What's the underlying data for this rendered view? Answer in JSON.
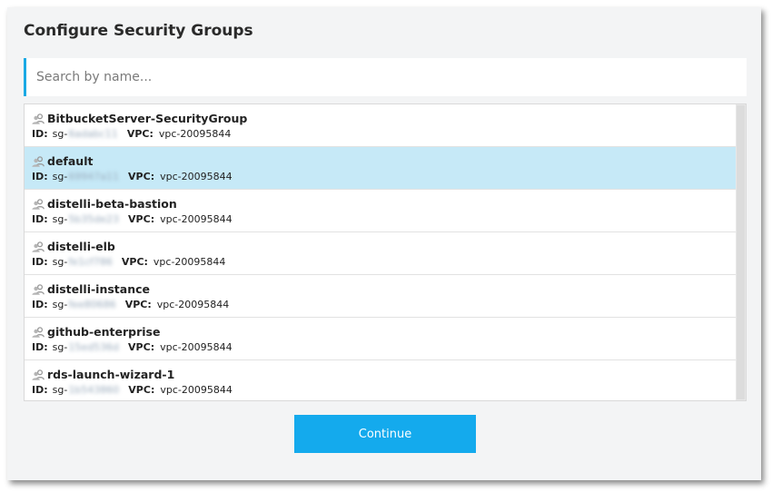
{
  "dialog": {
    "title": "Configure Security Groups",
    "search_placeholder": "Search by name...",
    "continue_label": "Continue"
  },
  "labels": {
    "id": "ID:",
    "vpc": "VPC:"
  },
  "groups": [
    {
      "name": "BitbucketServer-SecurityGroup",
      "id_prefix": "sg-",
      "id_rest": "6adabc11",
      "vpc": "vpc-20095844",
      "selected": false
    },
    {
      "name": "default",
      "id_prefix": "sg-",
      "id_rest": "69947a11",
      "vpc": "vpc-20095844",
      "selected": true
    },
    {
      "name": "distelli-beta-bastion",
      "id_prefix": "sg-",
      "id_rest": "5b35de23",
      "vpc": "vpc-20095844",
      "selected": false
    },
    {
      "name": "distelli-elb",
      "id_prefix": "sg-",
      "id_rest": "fe1cf786",
      "vpc": "vpc-20095844",
      "selected": false
    },
    {
      "name": "distelli-instance",
      "id_prefix": "sg-",
      "id_rest": "fee80686",
      "vpc": "vpc-20095844",
      "selected": false
    },
    {
      "name": "github-enterprise",
      "id_prefix": "sg-",
      "id_rest": "15ed536d",
      "vpc": "vpc-20095844",
      "selected": false
    },
    {
      "name": "rds-launch-wizard-1",
      "id_prefix": "sg-",
      "id_rest": "1b543860",
      "vpc": "vpc-20095844",
      "selected": false
    }
  ],
  "colors": {
    "accent": "#14aaed",
    "selected_row": "#c6e9f7"
  },
  "icons": {
    "group": "users-group-icon"
  }
}
